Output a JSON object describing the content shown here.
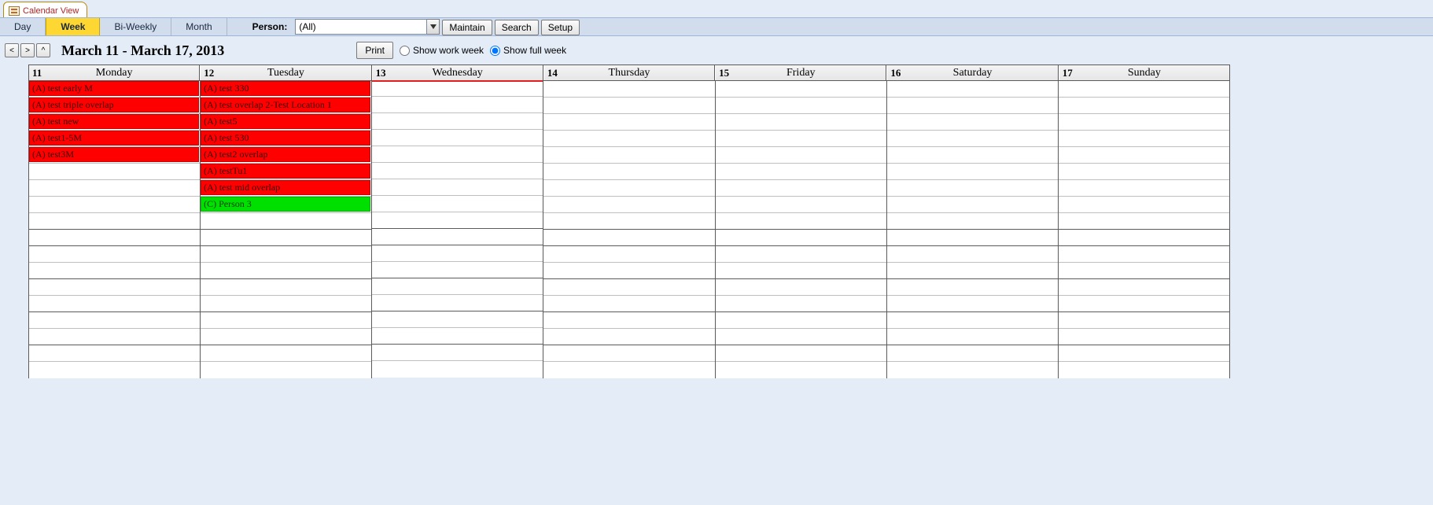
{
  "formTab": {
    "title": "Calendar View"
  },
  "viewTabs": [
    {
      "label": "Day",
      "active": false
    },
    {
      "label": "Week",
      "active": true
    },
    {
      "label": "Bi-Weekly",
      "active": false
    },
    {
      "label": "Month",
      "active": false
    }
  ],
  "person": {
    "label": "Person:",
    "value": "(All)"
  },
  "toolbarButtons": {
    "maintain": "Maintain",
    "search": "Search",
    "setup": "Setup"
  },
  "nav": {
    "prev": "<",
    "next": ">",
    "up": "^"
  },
  "dateRange": "March 11 - March 17, 2013",
  "printLabel": "Print",
  "weekOptions": {
    "workWeek": "Show work week",
    "fullWeek": "Show full week",
    "selected": "fullWeek"
  },
  "days": [
    {
      "date": "11",
      "name": "Monday"
    },
    {
      "date": "12",
      "name": "Tuesday"
    },
    {
      "date": "13",
      "name": "Wednesday"
    },
    {
      "date": "14",
      "name": "Thursday"
    },
    {
      "date": "15",
      "name": "Friday"
    },
    {
      "date": "16",
      "name": "Saturday"
    },
    {
      "date": "17",
      "name": "Sunday"
    }
  ],
  "slotsPerDay": 18,
  "todayIndex": 2,
  "events": [
    {
      "dayIndex": 0,
      "slot": 0,
      "label": "(A) test early M",
      "color": "red"
    },
    {
      "dayIndex": 0,
      "slot": 1,
      "label": "(A) test triple overlap",
      "color": "red"
    },
    {
      "dayIndex": 0,
      "slot": 2,
      "label": "(A) test new",
      "color": "red"
    },
    {
      "dayIndex": 0,
      "slot": 3,
      "label": "(A) test1-5M",
      "color": "red"
    },
    {
      "dayIndex": 0,
      "slot": 4,
      "label": "(A) test3M",
      "color": "red"
    },
    {
      "dayIndex": 1,
      "slot": 0,
      "label": "(A) test 330",
      "color": "red"
    },
    {
      "dayIndex": 1,
      "slot": 1,
      "label": "(A) test overlap 2-Test Location 1",
      "color": "red"
    },
    {
      "dayIndex": 1,
      "slot": 2,
      "label": "(A) test5",
      "color": "red"
    },
    {
      "dayIndex": 1,
      "slot": 3,
      "label": "(A) test 530",
      "color": "red"
    },
    {
      "dayIndex": 1,
      "slot": 4,
      "label": "(A) test2 overlap",
      "color": "red"
    },
    {
      "dayIndex": 1,
      "slot": 5,
      "label": "(A) testTu1",
      "color": "red"
    },
    {
      "dayIndex": 1,
      "slot": 6,
      "label": "(A) test mid overlap",
      "color": "red"
    },
    {
      "dayIndex": 1,
      "slot": 7,
      "label": "(C) Person 3",
      "color": "green"
    }
  ]
}
